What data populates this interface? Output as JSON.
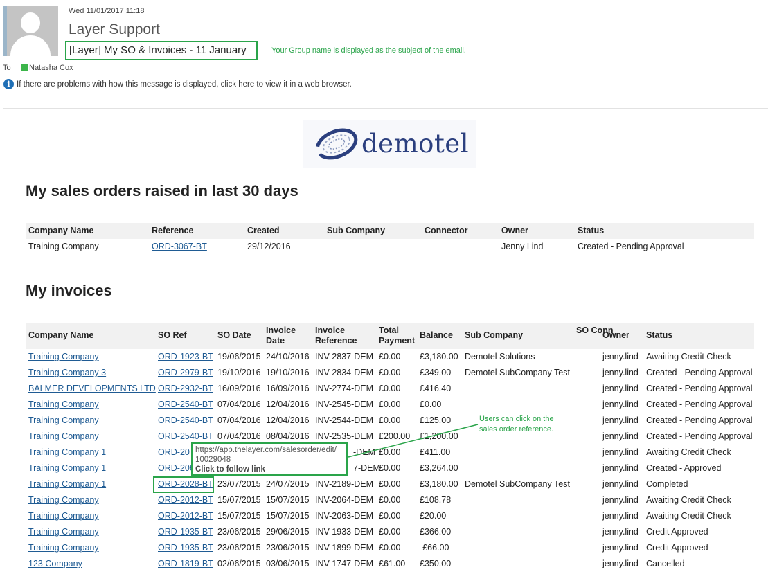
{
  "email": {
    "datetime": "Wed 11/01/2017 11:18",
    "sender": "Layer Support",
    "subject": "[Layer] My SO & Invoices - 11 January",
    "subject_note": "Your Group name is displayed as the subject of the email.",
    "to_label": "To",
    "to_name": "Natasha Cox",
    "info_text": "If there are problems with how this message is displayed, click here to view it in a web browser.",
    "status_color": "#3cb54a",
    "annotation_color": "#2aa44a"
  },
  "logo": {
    "text": "demotel",
    "color": "#2b3f7e"
  },
  "sales_orders": {
    "title": "My sales orders raised in last 30 days",
    "headers": [
      "Company Name",
      "Reference",
      "Created",
      "Sub Company",
      "Connector",
      "Owner",
      "Status"
    ],
    "rows": [
      [
        "Training Company",
        "ORD-3067-BT",
        "29/12/2016",
        "",
        "",
        "Jenny Lind",
        "Created - Pending Approval"
      ]
    ]
  },
  "invoices": {
    "title": "My invoices",
    "headers": [
      "Company Name",
      "SO Ref",
      "SO Date",
      "Invoice Date",
      "Invoice Reference",
      "Total Payment",
      "Balance",
      "Sub Company",
      "SO Conn",
      "Owner",
      "Status"
    ],
    "rows": [
      [
        "Training Company",
        "ORD-1923-BT",
        "19/06/2015",
        "24/10/2016",
        "INV-2837-DEM",
        "£0.00",
        "£3,180.00",
        "Demotel Solutions",
        "",
        "jenny.lind",
        "Awaiting Credit Check"
      ],
      [
        "Training Company 3",
        "ORD-2979-BT",
        "19/10/2016",
        "19/10/2016",
        "INV-2834-DEM",
        "£0.00",
        "£349.00",
        "Demotel SubCompany Test",
        "",
        "jenny.lind",
        "Created - Pending Approval"
      ],
      [
        "BALMER DEVELOPMENTS LTD",
        "ORD-2932-BT",
        "16/09/2016",
        "16/09/2016",
        "INV-2774-DEM",
        "£0.00",
        "£416.40",
        "",
        "",
        "jenny.lind",
        "Created - Pending Approval"
      ],
      [
        "Training Company",
        "ORD-2540-BT",
        "07/04/2016",
        "12/04/2016",
        "INV-2545-DEM",
        "£0.00",
        "£0.00",
        "",
        "",
        "jenny.lind",
        "Created - Pending Approval"
      ],
      [
        "Training Company",
        "ORD-2540-BT",
        "07/04/2016",
        "12/04/2016",
        "INV-2544-DEM",
        "£0.00",
        "£125.00",
        "",
        "",
        "jenny.lind",
        "Created - Pending Approval"
      ],
      [
        "Training Company",
        "ORD-2540-BT",
        "07/04/2016",
        "08/04/2016",
        "INV-2535-DEM",
        "£200.00",
        "£1,200.00",
        "",
        "",
        "jenny.lind",
        "Created - Pending Approval"
      ],
      [
        "Training Company 1",
        "ORD-207",
        "",
        "",
        "-DEM",
        "£0.00",
        "£411.00",
        "",
        "",
        "jenny.lind",
        "Awaiting Credit Check"
      ],
      [
        "Training Company 1",
        "ORD-206",
        "",
        "",
        "7-DEM",
        "£0.00",
        "£3,264.00",
        "",
        "",
        "jenny.lind",
        "Created - Approved"
      ],
      [
        "Training Company 1",
        "ORD-2028-BT",
        "23/07/2015",
        "24/07/2015",
        "INV-2189-DEM",
        "£0.00",
        "£3,180.00",
        "Demotel SubCompany Test",
        "",
        "jenny.lind",
        "Completed"
      ],
      [
        "Training Company",
        "ORD-2012-BT",
        "15/07/2015",
        "15/07/2015",
        "INV-2064-DEM",
        "£0.00",
        "£108.78",
        "",
        "",
        "jenny.lind",
        "Awaiting Credit Check"
      ],
      [
        "Training Company",
        "ORD-2012-BT",
        "15/07/2015",
        "15/07/2015",
        "INV-2063-DEM",
        "£0.00",
        "£20.00",
        "",
        "",
        "jenny.lind",
        "Awaiting Credit Check"
      ],
      [
        "Training Company",
        "ORD-1935-BT",
        "23/06/2015",
        "29/06/2015",
        "INV-1933-DEM",
        "£0.00",
        "£366.00",
        "",
        "",
        "jenny.lind",
        "Credit Approved"
      ],
      [
        "Training Company",
        "ORD-1935-BT",
        "23/06/2015",
        "23/06/2015",
        "INV-1899-DEM",
        "£0.00",
        "-£66.00",
        "",
        "",
        "jenny.lind",
        "Credit Approved"
      ],
      [
        "123 Company",
        "ORD-1819-BT",
        "02/06/2015",
        "03/06/2015",
        "INV-1747-DEM",
        "£61.00",
        "£350.00",
        "",
        "",
        "jenny.lind",
        "Cancelled"
      ]
    ]
  },
  "tooltip": {
    "url": "https://app.thelayer.com/salesorder/edit/",
    "id": "10029048",
    "follow": "Click to follow link"
  },
  "click_note": {
    "line1": "Users can click on the",
    "line2": "sales order reference."
  }
}
